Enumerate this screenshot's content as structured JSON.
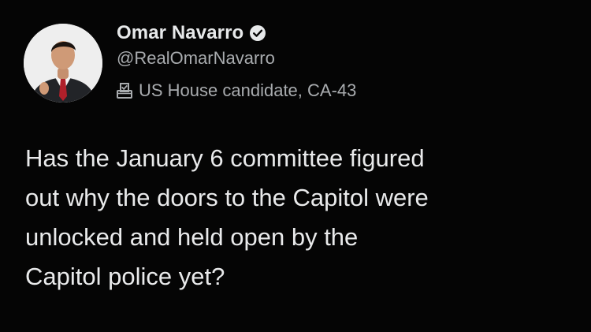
{
  "author": {
    "name": "Omar Navarro",
    "handle": "@RealOmarNavarro",
    "verified_icon": "verified-badge-icon",
    "label": "US House candidate, CA-43",
    "label_icon": "ballot-box-icon"
  },
  "tweet": {
    "text": "Has the January 6 committee figured\nout why the doors to the Capitol were\nunlocked and held open by the\nCapitol police yet?"
  },
  "colors": {
    "background": "#050505",
    "text_primary": "#e7e9ea",
    "text_secondary": "#a9acaf"
  }
}
